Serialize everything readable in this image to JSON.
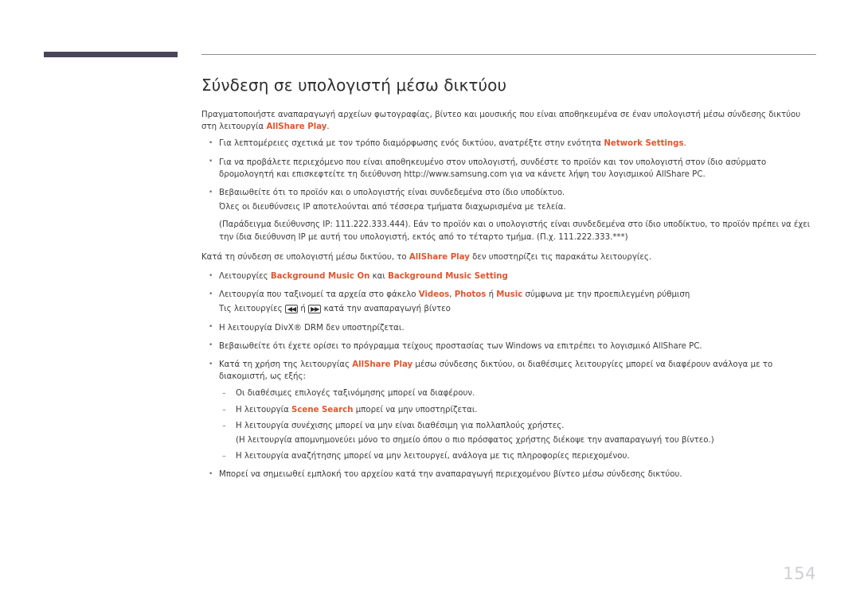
{
  "header": {
    "bar_color": "#4a4458",
    "rule_color": "#8d8d8d"
  },
  "accent_color": "#e2552e",
  "title": "Σύνδεση σε υπολογιστή μέσω δικτύου",
  "intro": {
    "part1": "Πραγματοποιήστε αναπαραγωγή αρχείων φωτογραφίας, βίντεο και μουσικής που είναι αποθηκευμένα σε έναν υπολογιστή μέσω σύνδεσης δικτύου στη λειτουργία ",
    "accent": "AllShare Play",
    "part2": "."
  },
  "bullets_1": [
    {
      "part1": "Για λεπτομέρειες σχετικά με τον τρόπο διαμόρφωσης ενός δικτύου, ανατρέξτε στην ενότητα ",
      "accent": "Network Settings",
      "part2": "."
    },
    {
      "part1": "Για να προβάλετε περιεχόμενο που είναι αποθηκευμένο στον υπολογιστή, συνδέστε το προϊόν και τον υπολογιστή στον ίδιο ασύρματο δρομολογητή και επισκεφτείτε τη διεύθυνση http://www.samsung.com για να κάνετε λήψη του λογισμικού AllShare PC."
    },
    {
      "part1": "Βεβαιωθείτε ότι το προϊόν και ο υπολογιστής είναι συνδεδεμένα στο ίδιο υποδίκτυο.",
      "line2": "Όλες οι διευθύνσεις IP αποτελούνται από τέσσερα τμήματα διαχωρισμένα με τελεία.",
      "line3": "(Παράδειγμα διεύθυνσης IP: 111.222.333.444). Εάν το προϊόν και ο υπολογιστής είναι συνδεδεμένα στο ίδιο υποδίκτυο, το προϊόν πρέπει να έχει την ίδια διεύθυνση IP με αυτή του υπολογιστή, εκτός από το τέταρτο τμήμα. (Π.χ. 111.222.333.***)"
    }
  ],
  "mid_paragraph": {
    "part1": "Κατά τη σύνδεση σε υπολογιστή μέσω δικτύου, το ",
    "accent": "AllShare Play",
    "part2": " δεν υποστηρίζει τις παρακάτω λειτουργίες."
  },
  "bullets_2": [
    {
      "part1": "Λειτουργίες ",
      "accent1": "Background Music On",
      "mid": " και ",
      "accent2": "Background Music Setting"
    },
    {
      "part1": "Λειτουργία που ταξινομεί τα αρχεία στο φάκελο ",
      "accent1": "Videos",
      "sep1": ", ",
      "accent2": "Photos",
      "sep2": " ή ",
      "accent3": "Music",
      "part2": " σύμφωνα με την προεπιλεγμένη ρύθμιση",
      "line2_pre": "Τις λειτουργίες ",
      "key_rewind": "◀◀",
      "line2_mid": " ή ",
      "key_forward": "▶▶",
      "line2_post": " κατά την αναπαραγωγή βίντεο"
    },
    {
      "part1": "Η λειτουργία DivX® DRM δεν υποστηρίζεται."
    },
    {
      "part1": "Βεβαιωθείτε ότι έχετε ορίσει το πρόγραμμα τείχους προστασίας των Windows να επιτρέπει το λογισμικό AllShare PC."
    }
  ],
  "allshare_block": {
    "part1": "Κατά τη χρήση της λειτουργίας ",
    "accent": "AllShare Play",
    "part2": " μέσω σύνδεσης δικτύου, οι διαθέσιμες λειτουργίες μπορεί να διαφέρουν ανάλογα με το διακομιστή, ως εξής:",
    "sub_items": [
      {
        "text": "Οι διαθέσιμες επιλογές ταξινόμησης μπορεί να διαφέρουν."
      },
      {
        "part1": "Η λειτουργία ",
        "accent": "Scene Search",
        "part2": " μπορεί να μην υποστηρίζεται."
      },
      {
        "part1": "Η λειτουργία συνέχισης μπορεί να μην είναι διαθέσιμη για πολλαπλούς χρήστες.",
        "line2": "(Η λειτουργία απομνημονεύει μόνο το σημείο όπου ο πιο πρόσφατος χρήστης διέκοψε την αναπαραγωγή του βίντεο.)"
      },
      {
        "text": "Η λειτουργία αναζήτησης μπορεί να μην λειτουργεί, ανάλογα με τις πληροφορίες περιεχομένου."
      }
    ]
  },
  "bullets_3": [
    {
      "part1": "Μπορεί να σημειωθεί εμπλοκή του αρχείου κατά την αναπαραγωγή περιεχομένου βίντεο μέσω σύνδεσης δικτύου."
    }
  ],
  "page_number": "154"
}
